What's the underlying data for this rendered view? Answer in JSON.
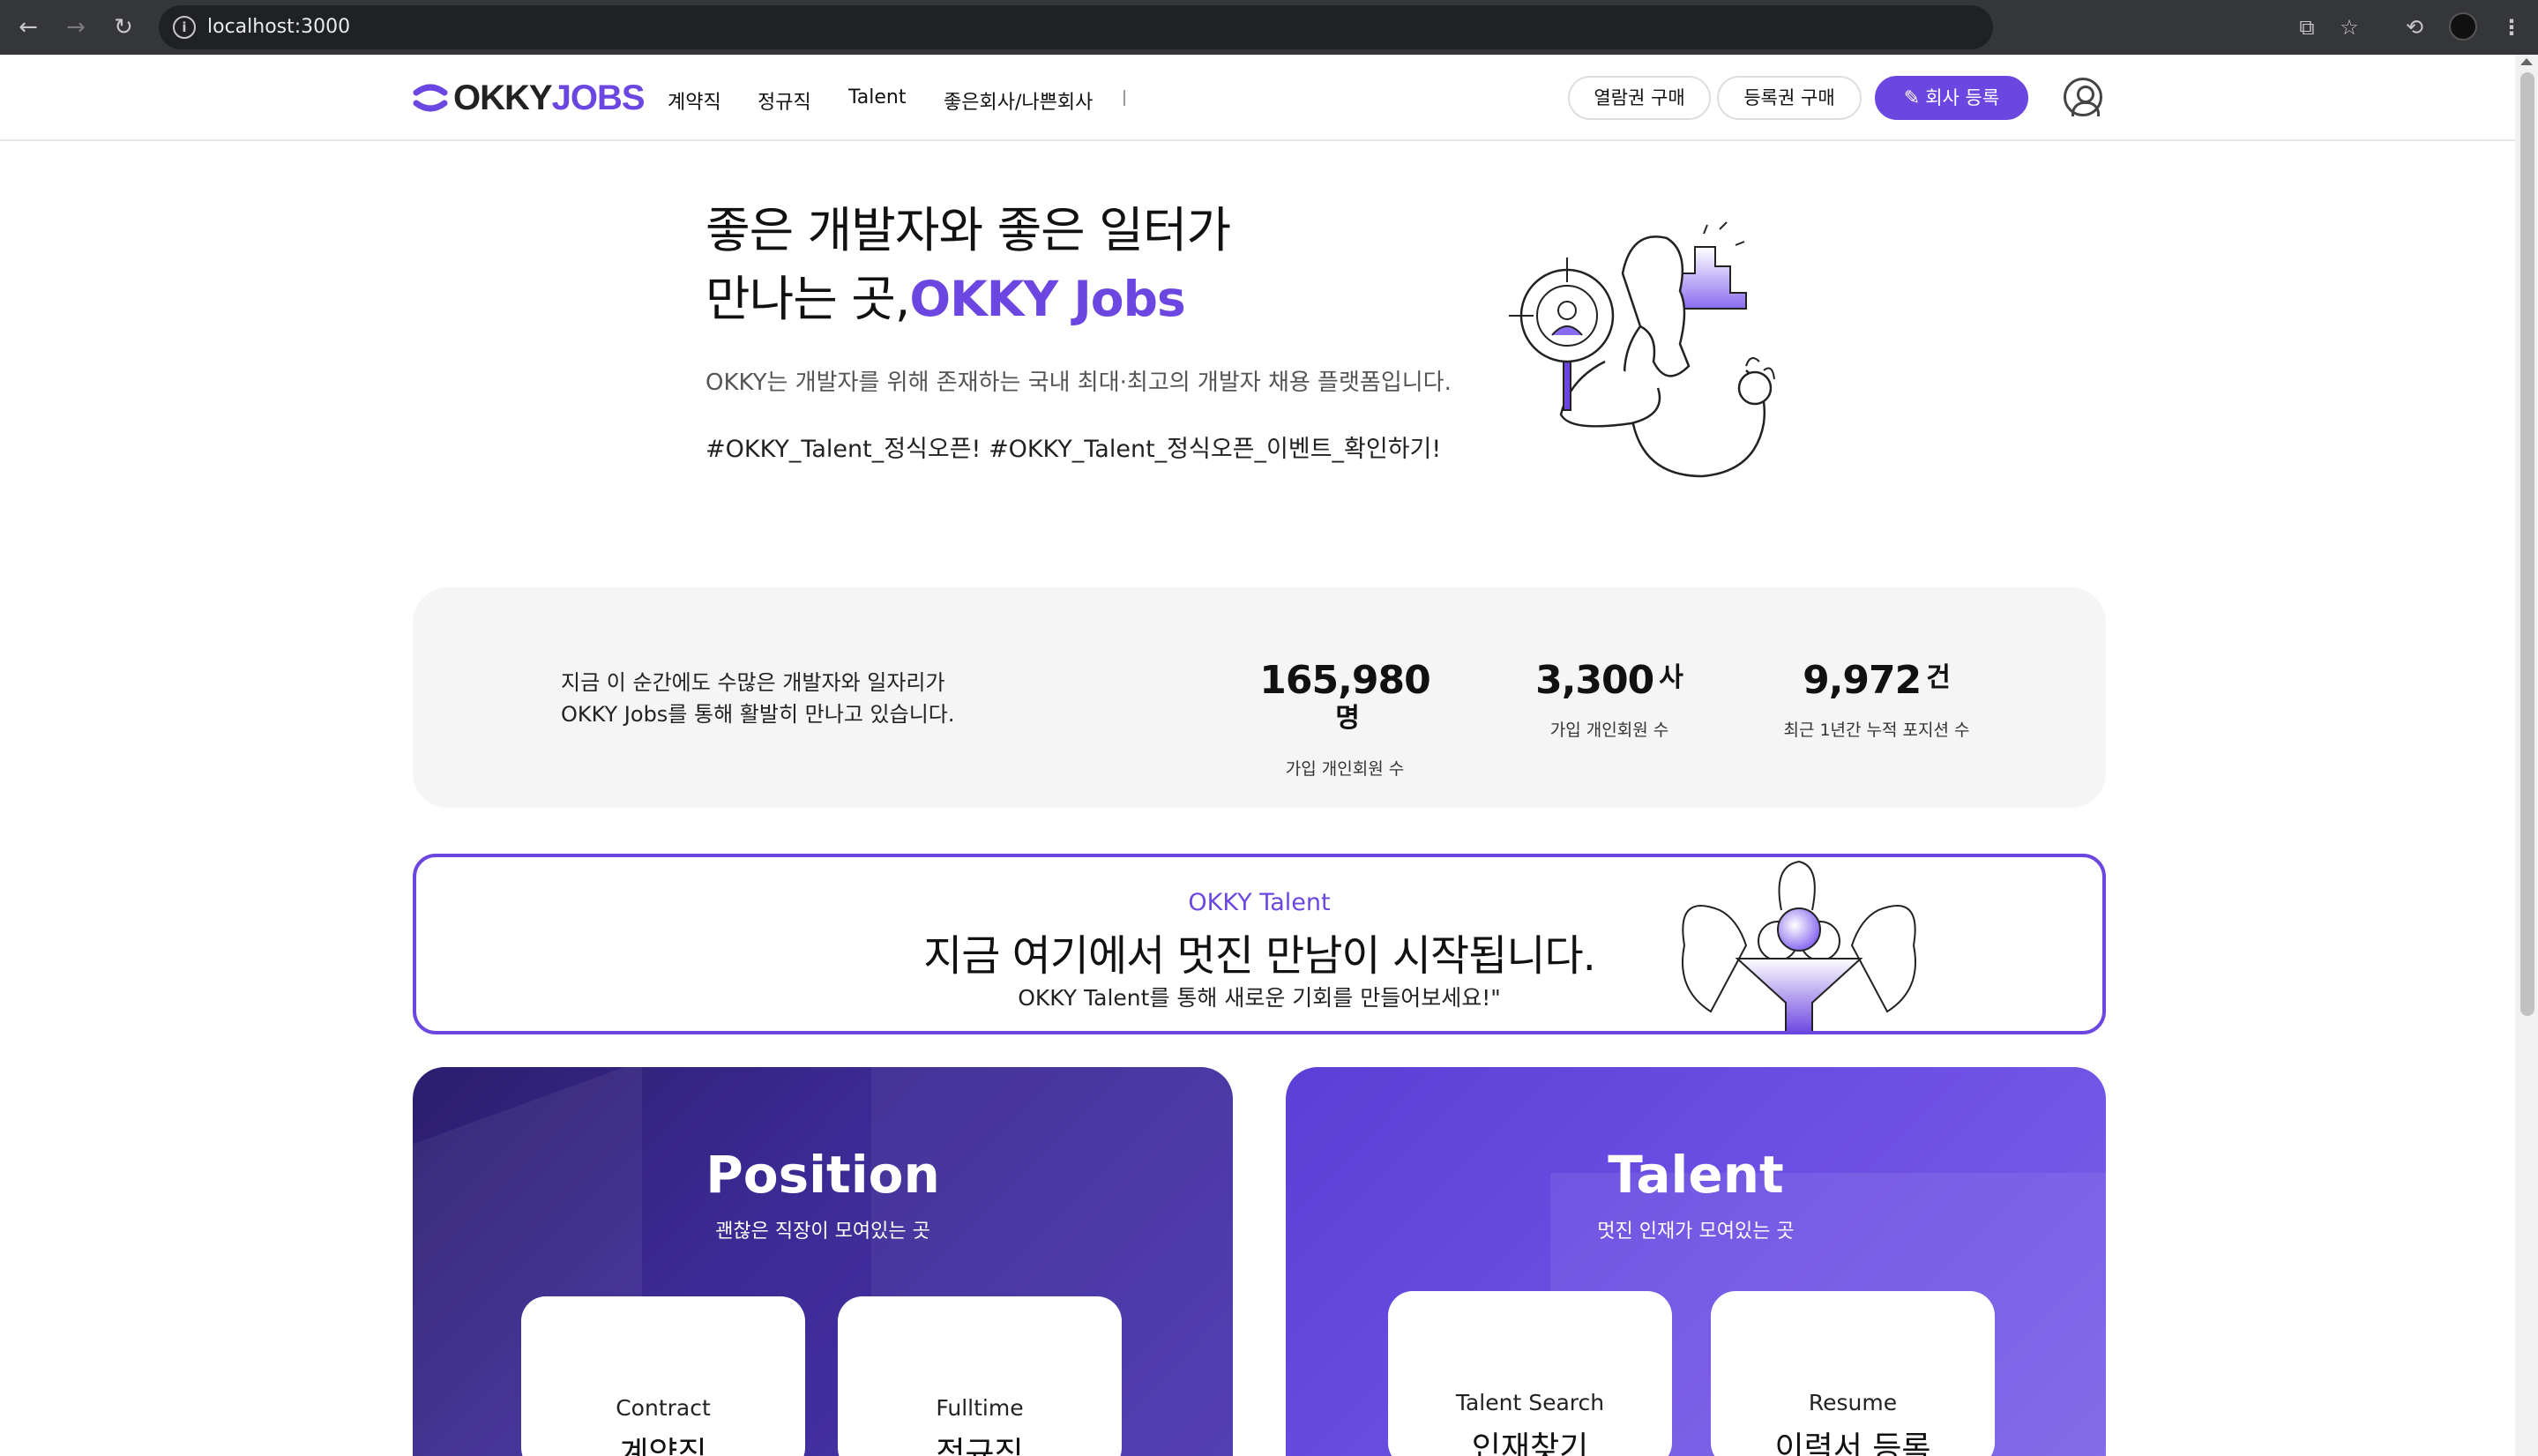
{
  "browser": {
    "url": "localhost:3000"
  },
  "header": {
    "logo": {
      "okky": "OKKY",
      "jobs": "JOBS"
    },
    "nav": [
      "계약직",
      "정규직",
      "Talent",
      "좋은회사/나쁜회사"
    ],
    "buttons": {
      "view_pass": "열람권 구매",
      "register_pass": "등록권 구매",
      "company_register": "회사 등록"
    }
  },
  "hero": {
    "title_line1": "좋은 개발자와 좋은 일터가",
    "title_line2_prefix": "만나는 곳,",
    "title_line2_accent": "OKKY Jobs",
    "description": "OKKY는 개발자를 위해 존재하는 국내 최대·최고의 개발자 채용 플랫폼입니다.",
    "tags": "#OKKY_Talent_정식오픈! #OKKY_Talent_정식오픈_이벤트_확인하기!"
  },
  "stats": {
    "intro_line1": "지금 이 순간에도 수많은 개발자와 일자리가",
    "intro_line2": "OKKY Jobs를 통해 활발히 만나고 있습니다.",
    "items": [
      {
        "value": "165,980",
        "unit": "명",
        "label": "가입 개인회원 수"
      },
      {
        "value": "3,300",
        "unit": "사",
        "label": "가입 개인회원 수"
      },
      {
        "value": "9,972",
        "unit": "건",
        "label": "최근 1년간 누적 포지션 수"
      }
    ]
  },
  "banner": {
    "kicker": "OKKY Talent",
    "headline": "지금 여기에서 멋진 만남이 시작됩니다.",
    "sub": "OKKY Talent를 통해 새로운 기회를 만들어보세요!\""
  },
  "cards": {
    "position": {
      "title": "Position",
      "subtitle": "괜찮은 직장이 모여있는 곳",
      "tiles": [
        {
          "en": "Contract",
          "ko": "계약직"
        },
        {
          "en": "Fulltime",
          "ko": "정규직"
        }
      ]
    },
    "talent": {
      "title": "Talent",
      "subtitle": "멋진 인재가 모여있는 곳",
      "tiles": [
        {
          "en": "Talent Search",
          "ko": "인재찾기"
        },
        {
          "en": "Resume",
          "ko": "이력서 등록"
        }
      ]
    }
  },
  "colors": {
    "brand": "#6b46e0",
    "chrome": "#35363a",
    "stats_bg": "#f5f5f5"
  }
}
